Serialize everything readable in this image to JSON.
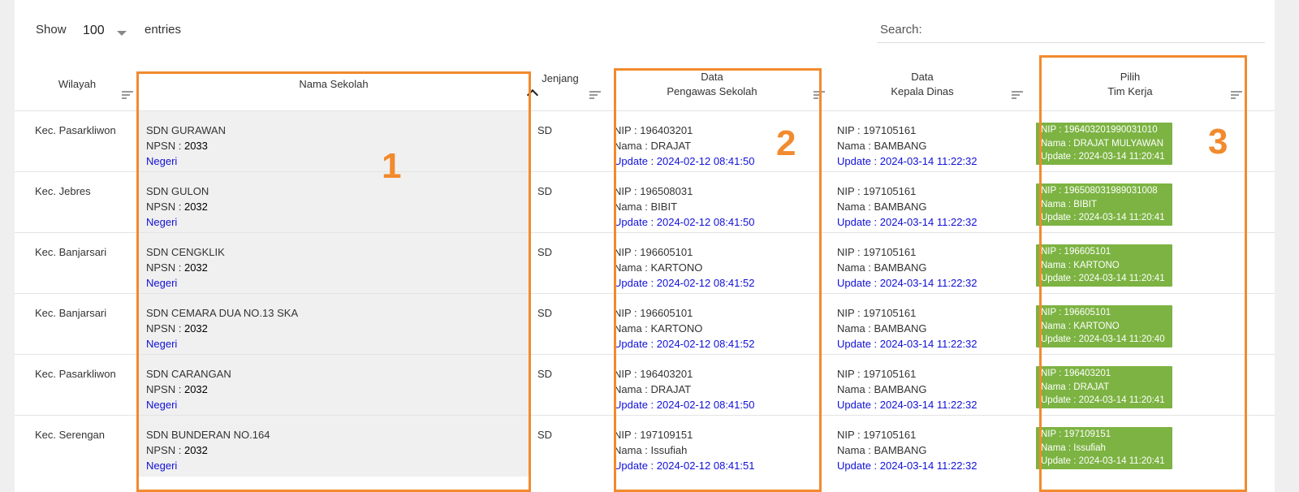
{
  "toolbar": {
    "show_label": "Show",
    "entries_value": "100",
    "entries_label": "entries",
    "search_label": "Search:",
    "search_value": ""
  },
  "columns": {
    "wilayah": "Wilayah",
    "nama_sekolah": "Nama Sekolah",
    "jenjang": "Jenjang",
    "pengawas_l1": "Data",
    "pengawas_l2": "Pengawas Sekolah",
    "kepala_l1": "Data",
    "kepala_l2": "Kepala Dinas",
    "tim_l1": "Pilih",
    "tim_l2": "Tim Kerja"
  },
  "rows": [
    {
      "wilayah": "Kec. Pasarkliwon",
      "school": "SDN GURAWAN",
      "npsn_label": "NPSN : ",
      "npsn": "2033",
      "status": "Negeri",
      "jenjang": "SD",
      "pengawas": {
        "nip": "NIP : 196403201",
        "nama": "Nama : DRAJAT",
        "update": "Update : 2024-02-12 08:41:50"
      },
      "kepala": {
        "nip": "NIP : 197105161",
        "nama": "Nama : BAMBANG",
        "update": "Update : 2024-03-14 11:22:32"
      },
      "tim": {
        "nip": "NIP : 196403201990031010",
        "nama": "Nama : DRAJAT MULYAWAN",
        "update": "Update : 2024-03-14 11:20:41"
      }
    },
    {
      "wilayah": "Kec. Jebres",
      "school": "SDN GULON",
      "npsn_label": "NPSN : ",
      "npsn": "2032",
      "status": "Negeri",
      "jenjang": "SD",
      "pengawas": {
        "nip": "NIP : 196508031",
        "nama": "Nama : BIBIT",
        "update": "Update : 2024-02-12 08:41:50"
      },
      "kepala": {
        "nip": "NIP : 197105161",
        "nama": "Nama : BAMBANG",
        "update": "Update : 2024-03-14 11:22:32"
      },
      "tim": {
        "nip": "NIP : 196508031989031008",
        "nama": "Nama : BIBIT",
        "update": "Update : 2024-03-14 11:20:41"
      }
    },
    {
      "wilayah": "Kec. Banjarsari",
      "school": "SDN CENGKLIK",
      "npsn_label": "NPSN : ",
      "npsn": "2032",
      "status": "Negeri",
      "jenjang": "SD",
      "pengawas": {
        "nip": "NIP : 196605101",
        "nama": "Nama : KARTONO",
        "update": "Update : 2024-02-12 08:41:52"
      },
      "kepala": {
        "nip": "NIP : 197105161",
        "nama": "Nama : BAMBANG",
        "update": "Update : 2024-03-14 11:22:32"
      },
      "tim": {
        "nip": "NIP : 196605101",
        "nama": "Nama : KARTONO",
        "update": "Update : 2024-03-14 11:20:41"
      }
    },
    {
      "wilayah": "Kec. Banjarsari",
      "school": "SDN CEMARA DUA NO.13 SKA",
      "npsn_label": "NPSN : ",
      "npsn": "2032",
      "status": "Negeri",
      "jenjang": "SD",
      "pengawas": {
        "nip": "NIP : 196605101",
        "nama": "Nama : KARTONO",
        "update": "Update : 2024-02-12 08:41:52"
      },
      "kepala": {
        "nip": "NIP : 197105161",
        "nama": "Nama : BAMBANG",
        "update": "Update : 2024-03-14 11:22:32"
      },
      "tim": {
        "nip": "NIP : 196605101",
        "nama": "Nama : KARTONO",
        "update": "Update : 2024-03-14 11:20:40"
      }
    },
    {
      "wilayah": "Kec. Pasarkliwon",
      "school": "SDN CARANGAN",
      "npsn_label": "NPSN : ",
      "npsn": "2032",
      "status": "Negeri",
      "jenjang": "SD",
      "pengawas": {
        "nip": "NIP : 196403201",
        "nama": "Nama : DRAJAT",
        "update": "Update : 2024-02-12 08:41:50"
      },
      "kepala": {
        "nip": "NIP : 197105161",
        "nama": "Nama : BAMBANG",
        "update": "Update : 2024-03-14 11:22:32"
      },
      "tim": {
        "nip": "NIP : 196403201",
        "nama": "Nama : DRAJAT",
        "update": "Update : 2024-03-14 11:20:41"
      }
    },
    {
      "wilayah": "Kec. Serengan",
      "school": "SDN BUNDERAN NO.164",
      "npsn_label": "NPSN : ",
      "npsn": "2032",
      "status": "Negeri",
      "jenjang": "SD",
      "pengawas": {
        "nip": "NIP : 197109151",
        "nama": "Nama : Issufiah",
        "update": "Update : 2024-02-12 08:41:51"
      },
      "kepala": {
        "nip": "NIP : 197105161",
        "nama": "Nama : BAMBANG",
        "update": "Update : 2024-03-14 11:22:32"
      },
      "tim": {
        "nip": "NIP : 197109151",
        "nama": "Nama : Issufiah",
        "update": "Update : 2024-03-14 11:20:41"
      }
    }
  ],
  "annotations": {
    "one": "1",
    "two": "2",
    "three": "3"
  },
  "colors": {
    "highlight": "#f28a2e",
    "badge": "#7cb342",
    "link": "#1010d8"
  }
}
